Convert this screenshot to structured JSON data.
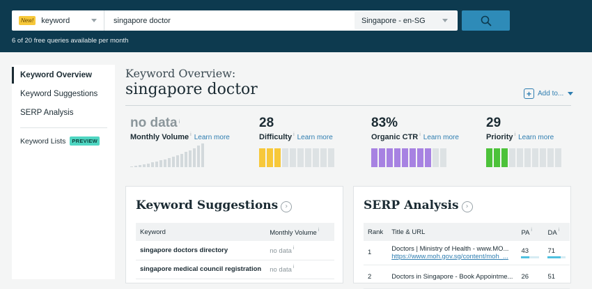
{
  "search": {
    "new_badge": "New!",
    "type": "keyword",
    "query": "singapore doctor",
    "locale": "Singapore - en-SG",
    "quota": "6 of 20 free queries available per month"
  },
  "sidebar": {
    "items": [
      {
        "label": "Keyword Overview"
      },
      {
        "label": "Keyword Suggestions"
      },
      {
        "label": "SERP Analysis"
      },
      {
        "label": "Keyword Lists",
        "badge": "PREVIEW"
      }
    ]
  },
  "header": {
    "title": "Keyword Overview:",
    "keyword": "singapore doctor",
    "add_to": "Add to..."
  },
  "metrics": {
    "info": "i",
    "learn_more": "Learn more",
    "volume": {
      "value": "no data",
      "label": "Monthly Volume",
      "bar_levels": [
        0.04,
        0.07,
        0.1,
        0.13,
        0.16,
        0.2,
        0.24,
        0.28,
        0.33,
        0.38,
        0.44,
        0.5,
        0.57,
        0.64,
        0.72,
        0.8,
        0.9,
        1.0
      ]
    },
    "difficulty": {
      "value": "28",
      "label": "Difficulty",
      "filled": 3,
      "total": 10,
      "color": "#f7c83a"
    },
    "ctr": {
      "value": "83%",
      "label": "Organic CTR",
      "filled": 8,
      "total": 10,
      "color": "#a782e2"
    },
    "priority": {
      "value": "29",
      "label": "Priority",
      "filled": 3,
      "total": 10,
      "color": "#4cc23a"
    }
  },
  "suggestions": {
    "title": "Keyword Suggestions",
    "arrow": "›",
    "columns": [
      "Keyword",
      "Monthly Volume"
    ],
    "rows": [
      {
        "keyword": "singapore doctors directory",
        "volume": "no data"
      },
      {
        "keyword": "singapore medical council registration",
        "volume": "no data"
      }
    ]
  },
  "serp": {
    "title": "SERP Analysis",
    "arrow": "›",
    "columns": [
      "Rank",
      "Title & URL",
      "PA",
      "DA"
    ],
    "rows": [
      {
        "rank": "1",
        "title": "Doctors | Ministry of Health - www.MO...",
        "url": "https://www.moh.gov.sg/content/moh_...",
        "pa": "43",
        "da": "71"
      },
      {
        "rank": "2",
        "title": "Doctors in Singapore - Book Appointme...",
        "url": "",
        "pa": "26",
        "da": "51"
      }
    ]
  },
  "colors": {
    "topbar": "#0d3a4f",
    "accent": "#2e8bb8",
    "link": "#2e7db0"
  }
}
